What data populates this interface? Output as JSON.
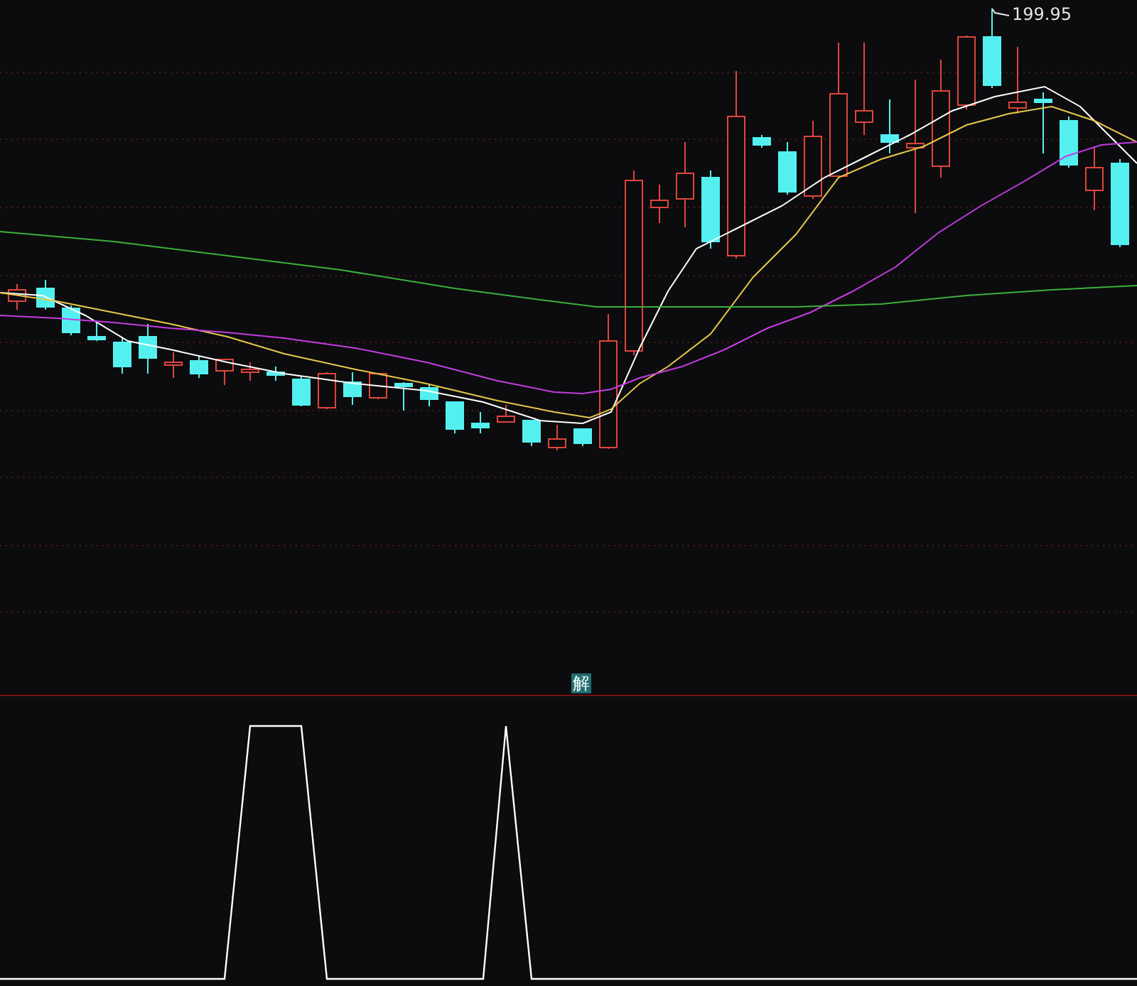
{
  "price_chart": {
    "high_label": "199.95"
  },
  "indicator": {
    "badge": "解"
  }
}
